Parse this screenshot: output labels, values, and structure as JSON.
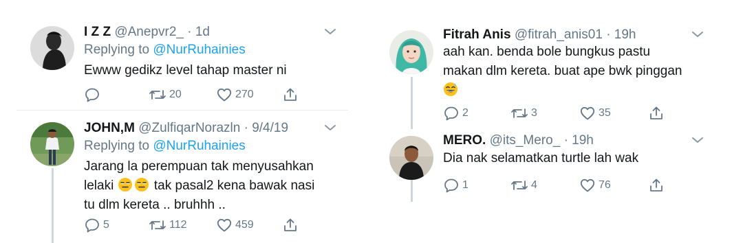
{
  "left_column": {
    "tweets": [
      {
        "name": "I Z Z",
        "handle": "@Anepvr2_",
        "sep": "·",
        "time": "1d",
        "reply_prefix": "Replying to",
        "reply_to": "@NurRuhainies",
        "text": "Ewww gedikz level tahap master ni",
        "replies": "",
        "retweets": "20",
        "likes": "270"
      },
      {
        "name": "JOHN,M",
        "handle": "@ZulfiqarNorazln",
        "sep": "·",
        "time": "9/4/19",
        "reply_prefix": "Replying to",
        "reply_to": "@NurRuhainies",
        "text_line1": "Jarang la perempuan tak menyusahkan",
        "text_line2_a": "lelaki",
        "text_line2_b": "tak pasal2 kena bawak nasi",
        "text_line3": "tu dlm kereta .. bruhhh ..",
        "replies": "5",
        "retweets": "112",
        "likes": "459"
      }
    ]
  },
  "right_column": {
    "tweets": [
      {
        "name": "Fitrah Anis",
        "handle": "@fitrah_anis01",
        "sep": "·",
        "time": "19h",
        "text_line1": "aah kan. benda bole bungkus pastu",
        "text_line2": "makan dlm kereta. buat ape bwk pinggan",
        "replies": "2",
        "retweets": "3",
        "likes": "35"
      },
      {
        "name": "MERO.",
        "handle": "@its_Mero_",
        "sep": "·",
        "time": "19h",
        "text": "Dia nak selamatkan turtle lah wak",
        "replies": "1",
        "retweets": "4",
        "likes": "76"
      }
    ]
  },
  "icons": {
    "reply": "reply-icon",
    "retweet": "retweet-icon",
    "like": "heart-icon",
    "share": "share-icon",
    "more": "chevron-down-icon",
    "emoji_expressionless": "expressionless-face-emoji",
    "emoji_sweat_smile": "grinning-sweat-emoji"
  },
  "colors": {
    "text": "#14171a",
    "muted": "#657786",
    "link": "#1da1f2",
    "divider": "#e6ecf0",
    "thread_line": "#ccd6dd"
  }
}
